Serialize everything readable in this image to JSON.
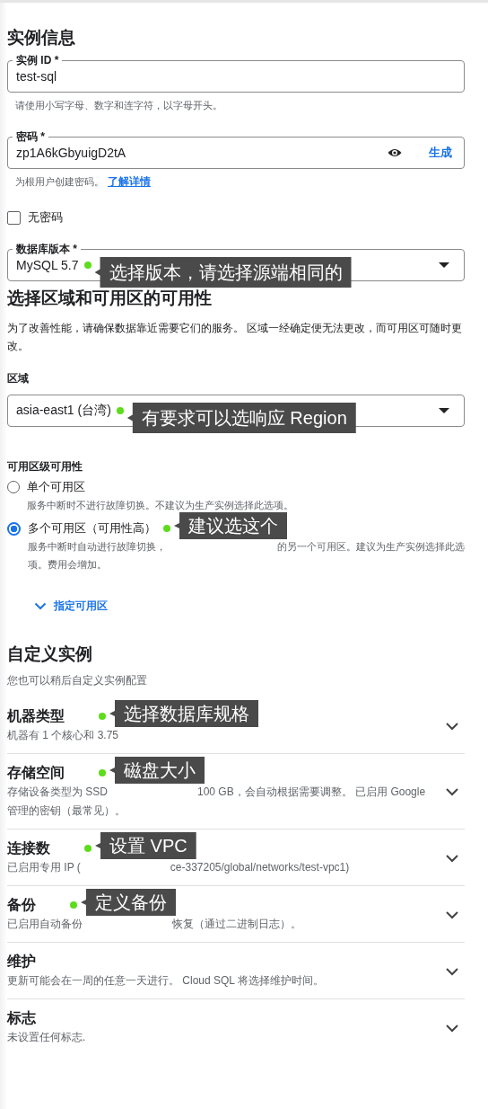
{
  "instance_info": {
    "title": "实例信息",
    "instance_id": {
      "label": "实例 ID *",
      "value": "test-sql",
      "hint": "请使用小写字母、数字和连字符，以字母开头。"
    },
    "password": {
      "label": "密码 *",
      "value": "zp1A6kGbyuigD2tA",
      "generate": "生成",
      "hint": "为根用户创建密码。",
      "hint_link": "了解详情"
    },
    "no_password": {
      "label": "无密码",
      "checked": false
    },
    "db_version": {
      "label": "数据库版本 *",
      "value": "MySQL 5.7",
      "annotation": "选择版本，请选择源端相同的"
    }
  },
  "region_section": {
    "title": "选择区域和可用区的可用性",
    "description": "为了改善性能，请确保数据靠近需要它们的服务。 区域一经确定便无法更改，而可用区可随时更改。",
    "region_label": "区域",
    "region": {
      "value": "asia-east1 (台湾)",
      "annotation": "有要求可以选响应 Region"
    },
    "zonal_label": "可用区级可用性",
    "options": [
      {
        "label": "单个可用区",
        "description_parts": [
          "服务中断时不进行故障切换。不建议为生产实例选择此选项。"
        ],
        "selected": false
      },
      {
        "label": "多个可用区（可用性高）",
        "description_parts": [
          "服务中断时自动进行故障切换，",
          "的另一个可用区。建议为生产实例选择此选项。费用会增加。"
        ],
        "annotation": "建议选这个",
        "selected": true
      }
    ],
    "specify_zones": "指定可用区"
  },
  "customize": {
    "title": "自定义实例",
    "subtitle": "您也可以稍后自定义实例配置",
    "items": [
      {
        "title": "机器类型",
        "description_parts": [
          "机器有 1 个核心和 3.75"
        ],
        "annotation": "选择数据库规格"
      },
      {
        "title": "存储空间",
        "description_parts": [
          "存储设备类型为 SSD",
          "100 GB，会自动根据需要调整。 已启用 Google 管理的密钥（最常见）。"
        ],
        "annotation": "磁盘大小"
      },
      {
        "title": "连接数",
        "description_parts": [
          "已启用专用 IP (",
          "ce-337205/global/networks/test-vpc1)"
        ],
        "annotation": "设置 VPC"
      },
      {
        "title": "备份",
        "description_parts": [
          "已启用自动备份",
          "恢复（通过二进制日志）。"
        ],
        "annotation": "定义备份"
      },
      {
        "title": "维护",
        "description_parts": [
          "更新可能会在一周的任意一天进行。 Cloud SQL 将选择维护时间。"
        ]
      },
      {
        "title": "标志",
        "description_parts": [
          "未设置任何标志."
        ]
      }
    ]
  }
}
